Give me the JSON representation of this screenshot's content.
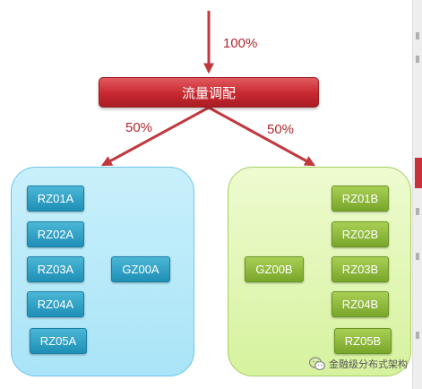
{
  "title": "流量调配",
  "edges": {
    "inbound_label": "100%",
    "left_label": "50%",
    "right_label": "50%"
  },
  "groups": {
    "a": {
      "rz": [
        "RZ01A",
        "RZ02A",
        "RZ03A",
        "RZ04A",
        "RZ05A"
      ],
      "gz": "GZ00A"
    },
    "b": {
      "rz": [
        "RZ01B",
        "RZ02B",
        "RZ03B",
        "RZ04B",
        "RZ05B"
      ],
      "gz": "GZ00B"
    }
  },
  "watermark": {
    "text": "金融级分布式架构",
    "icon": "wechat-icon"
  },
  "colors": {
    "arrow": "#c0393f",
    "dispatch": "#c8282f",
    "group_a_fill": "#bdebfa",
    "group_b_fill": "#e3f6b8",
    "node_blue": "#2a9cc2",
    "node_green": "#86b236"
  }
}
